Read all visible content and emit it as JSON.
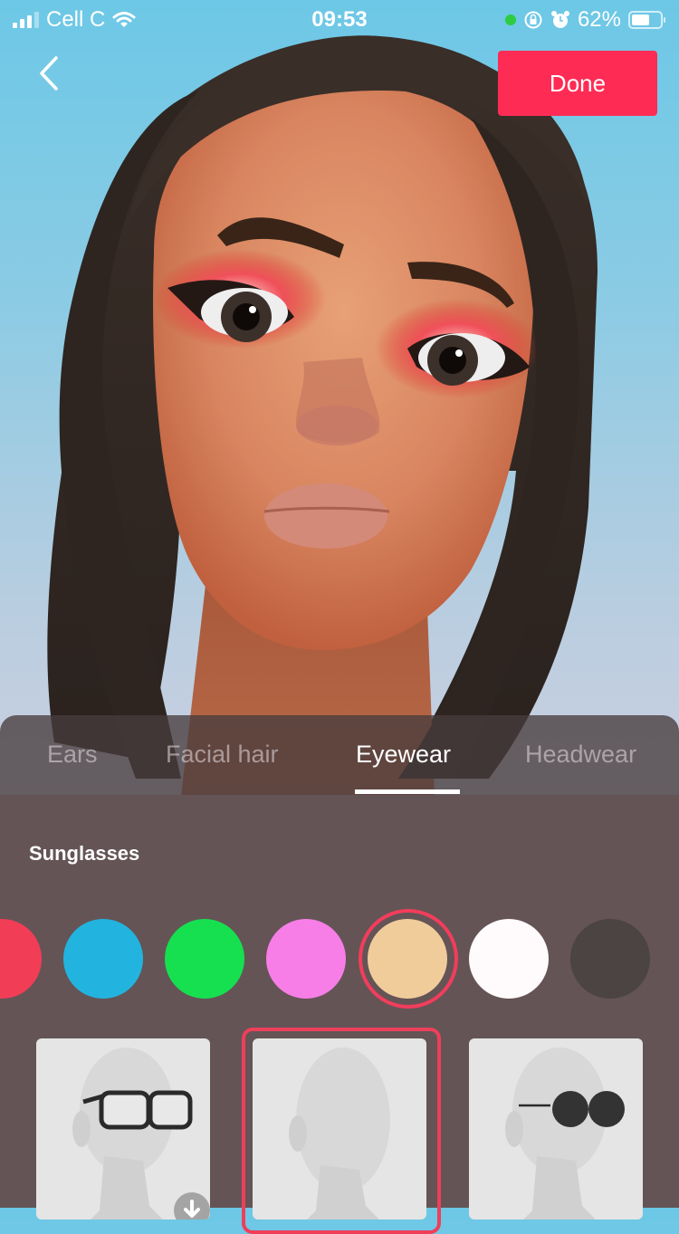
{
  "status_bar": {
    "carrier": "Cell C",
    "time": "09:53",
    "battery_percent": "62%",
    "battery_level": 0.62,
    "icons": [
      "signal-icon",
      "wifi-icon",
      "active-indicator-dot",
      "rotation-lock-icon",
      "alarm-icon",
      "battery-icon"
    ]
  },
  "header": {
    "back_icon": "chevron-left-icon",
    "done_label": "Done",
    "done_color": "#fe2c55"
  },
  "tabs": [
    {
      "label": "Ears",
      "active": false
    },
    {
      "label": "Facial hair",
      "active": false
    },
    {
      "label": "Eyewear",
      "active": true
    },
    {
      "label": "Headwear",
      "active": false
    }
  ],
  "section": {
    "title": "Sunglasses"
  },
  "colors": {
    "selected_index": 4,
    "swatches": [
      {
        "name": "red",
        "hex": "#f23d57"
      },
      {
        "name": "blue",
        "hex": "#22b4de"
      },
      {
        "name": "green",
        "hex": "#16e050"
      },
      {
        "name": "pink",
        "hex": "#f77ee7"
      },
      {
        "name": "tan",
        "hex": "#f1cc9b"
      },
      {
        "name": "white",
        "hex": "#fffbfc"
      },
      {
        "name": "dark-gray",
        "hex": "#4b4442"
      }
    ]
  },
  "styles": {
    "selected_index": 1,
    "items": [
      {
        "name": "square-frame-glasses",
        "download_required": true,
        "download_icon": "download-icon"
      },
      {
        "name": "none",
        "download_required": false
      },
      {
        "name": "round-dark-sunglasses",
        "download_required": false
      }
    ]
  },
  "accent_color": "#ee3f5a"
}
